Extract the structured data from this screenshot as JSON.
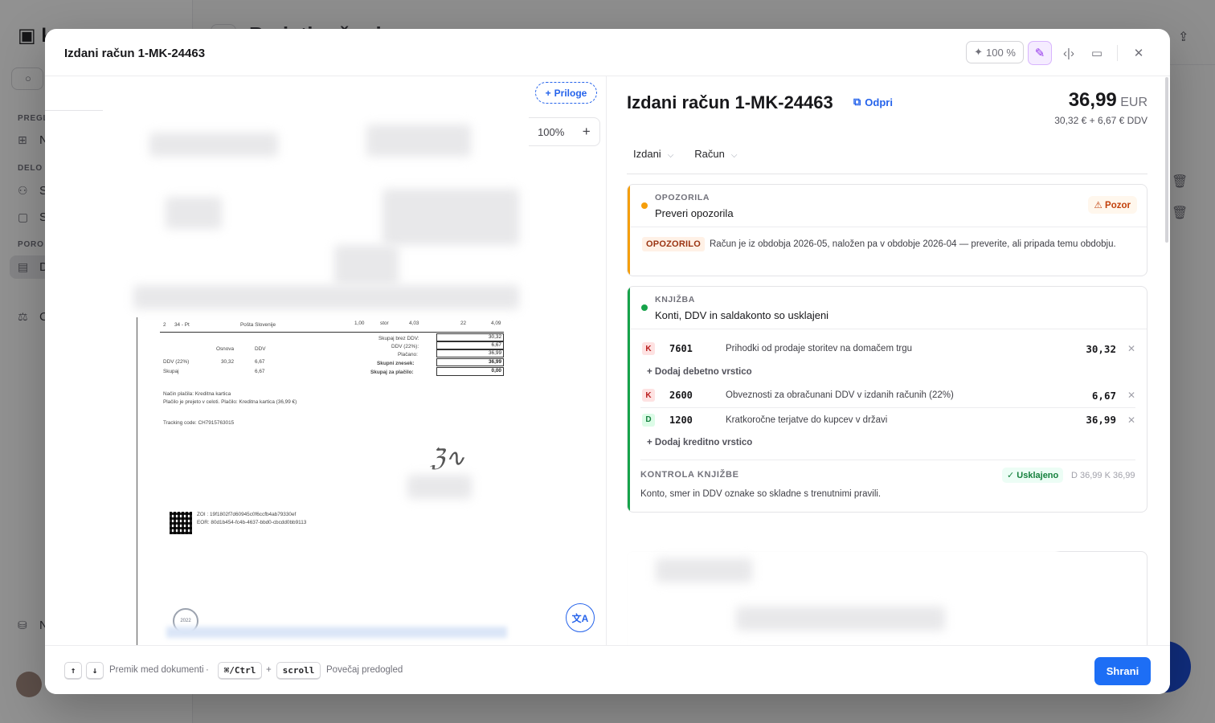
{
  "background": {
    "sidebar_sections": [
      "PREGL",
      "DELO",
      "PORO"
    ],
    "sidebar_items": [
      "N",
      "S",
      "S",
      "D",
      "C",
      "N"
    ],
    "main_title": "Prejeti računi"
  },
  "modal": {
    "title": "Izdani račun 1-MK-24463",
    "zoom_chip": "100 %",
    "icons": [
      "sparkle-icon",
      "note-icon",
      "code-icon",
      "folder-icon",
      "close-icon"
    ]
  },
  "preview": {
    "attachments_label": "Priloge",
    "zoom_value": "100%",
    "zoom_plus": "+",
    "translate_label": "文A",
    "document": {
      "item_row": [
        "2",
        "34 - Pt",
        "Pošta Slovenije",
        "1,00",
        "stor",
        "4,03",
        "22",
        "4,09"
      ],
      "totals": [
        {
          "label": "Skupaj brez DDV:",
          "value": "30,32"
        },
        {
          "label": "DDV (22%):",
          "value": "6,67"
        },
        {
          "label": "Plačano:",
          "value": "36,99"
        },
        {
          "label": "Skupni znesek:",
          "value": "36,99"
        },
        {
          "label": "Skupaj za plačilo:",
          "value": "0,00"
        }
      ],
      "vat_table_headers": [
        "Osnova",
        "DDV"
      ],
      "vat_rows": [
        [
          "DDV (22%)",
          "30,32",
          "6,67"
        ],
        [
          "Skupaj",
          "",
          "6,67"
        ]
      ],
      "payment_line1": "Način plačila: Kreditna kartica",
      "payment_line2": "Plačilo je prejeto v celoti. Plačilo: Kreditna kartica (36,99 €)",
      "tracking": "Tracking code: CH7915763015",
      "zoi": "ZOI : 19f1802f7d60945c0f6ccfb4ab79330ef",
      "eor": "EOR: 80d1b454-fc4b-4637-bbd0-cbcdd0bb9113",
      "stamp_year": "2022"
    }
  },
  "details": {
    "title": "Izdani račun 1-MK-24463",
    "open_label": "Odpri",
    "amount": "36,99",
    "currency": "EUR",
    "amount_breakdown": "30,32 € + 6,67 € DDV",
    "select_direction": "Izdani",
    "select_type": "Račun",
    "warnings": {
      "kicker": "OPOZORILA",
      "heading": "Preveri opozorila",
      "badge": "Pozor",
      "tag": "OPOZORILO",
      "text": "Račun je iz obdobja 2026-05, naložen pa v obdobje 2026-04 — preverite, ali pripada temu obdobju."
    },
    "booking": {
      "kicker": "KNJIŽBA",
      "heading": "Konti, DDV in saldakonto so usklajeni",
      "credit_rows": [
        {
          "side": "K",
          "account": "7601",
          "description": "Prihodki od prodaje storitev na domačem trgu",
          "amount": "30,32"
        }
      ],
      "add_debit": "+ Dodaj debetno vrstico",
      "rows2": [
        {
          "side": "K",
          "account": "2600",
          "description": "Obveznosti za obračunani DDV v izdanih računih (22%)",
          "amount": "6,67"
        },
        {
          "side": "D",
          "account": "1200",
          "description": "Kratkoročne terjatve do kupcev v državi",
          "amount": "36,99"
        }
      ],
      "add_credit": "+ Dodaj kreditno vrstico",
      "check_kicker": "KONTROLA KNJIŽBE",
      "check_badge": "Usklajeno",
      "check_dk": "D 36,99  K 36,99",
      "check_text": "Konto, smer in DDV oznake so skladne s trenutnimi pravili."
    }
  },
  "footer": {
    "key_up": "↑",
    "key_down": "↓",
    "nav_hint": "Premik med dokumenti",
    "dot": "·",
    "key_mod": "⌘/Ctrl",
    "plus": "+",
    "key_scroll": "scroll",
    "zoom_hint": "Povečaj predogled",
    "save_label": "Shrani"
  },
  "colors": {
    "accent": "#1d6ef5",
    "warning": "#f59e0b",
    "success": "#16a34a"
  }
}
